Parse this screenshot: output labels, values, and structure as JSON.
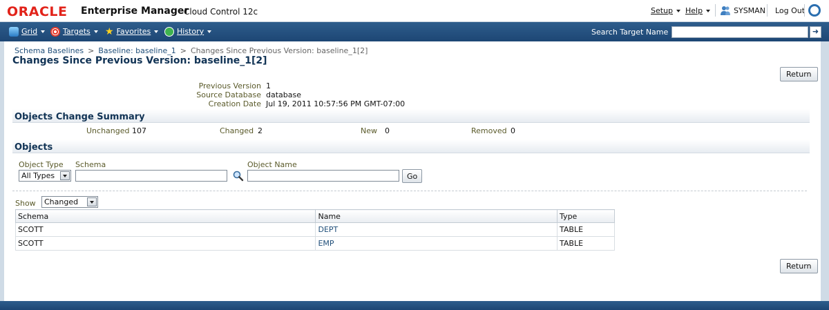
{
  "header": {
    "logo": "ORACLE",
    "product": "Enterprise Manager",
    "product_sub": "Cloud Control 12c",
    "setup": "Setup",
    "help": "Help",
    "user": "SYSMAN",
    "logout": "Log Out"
  },
  "nav": {
    "grid": "Grid",
    "targets": "Targets",
    "favorites": "Favorites",
    "history": "History",
    "search_label": "Search Target Name",
    "search_value": ""
  },
  "breadcrumb": {
    "items": [
      "Schema Baselines",
      "Baseline: baseline_1",
      "Changes Since Previous Version: baseline_1[2]"
    ],
    "separator": ">"
  },
  "page": {
    "title": "Changes Since Previous Version: baseline_1[2]",
    "return_label": "Return"
  },
  "properties": [
    {
      "label": "Previous Version",
      "value": "1"
    },
    {
      "label": "Source Database",
      "value": "database"
    },
    {
      "label": "Creation Date",
      "value": "Jul 19, 2011 10:57:56 PM GMT-07:00"
    }
  ],
  "summary": {
    "title": "Objects Change Summary",
    "items": [
      {
        "label": "Unchanged",
        "value": "107"
      },
      {
        "label": "Changed",
        "value": "2"
      },
      {
        "label": "New",
        "value": "0"
      },
      {
        "label": "Removed",
        "value": "0"
      }
    ]
  },
  "objects": {
    "title": "Objects",
    "object_type_label": "Object Type",
    "object_type_value": "All Types",
    "schema_label": "Schema",
    "schema_value": "",
    "object_name_label": "Object Name",
    "object_name_value": "",
    "go_label": "Go",
    "show_label": "Show",
    "show_value": "Changed",
    "columns": [
      "Schema",
      "Name",
      "Type"
    ],
    "rows": [
      {
        "schema": "SCOTT",
        "name": "DEPT",
        "type": "TABLE"
      },
      {
        "schema": "SCOTT",
        "name": "EMP",
        "type": "TABLE"
      }
    ]
  },
  "icons": {
    "grid": "grid-icon",
    "targets": "targets-icon",
    "favorites": "star-icon",
    "history": "history-icon",
    "user": "user-icon",
    "search": "magnifier-icon"
  },
  "colors": {
    "nav_bar": "#1d4674",
    "logo_red": "#e2231a",
    "title_blue": "#113355",
    "link_blue": "#1f4e79",
    "label_olive": "#5a5a2a"
  }
}
